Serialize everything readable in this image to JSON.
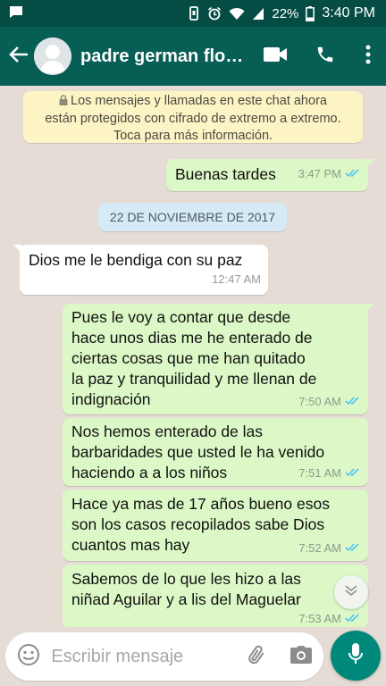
{
  "status_bar": {
    "battery": "22%",
    "time": "3:40 PM",
    "icons": [
      "chat-notification-icon",
      "vibrate-icon",
      "alarm-icon",
      "wifi-icon",
      "signal-icon",
      "battery-icon"
    ]
  },
  "header": {
    "contact_name": "padre german flo…",
    "icons": [
      "back-arrow-icon",
      "avatar-placeholder-icon",
      "video-call-icon",
      "phone-icon",
      "more-vert-icon"
    ]
  },
  "encryption_notice": {
    "line1": "Los mensajes y llamadas en este chat ahora",
    "line2": "están protegidos con cifrado de extremo a extremo.",
    "line3": "Toca para más información."
  },
  "messages": [
    {
      "direction": "out",
      "text": "Buenas tardes",
      "time": "3:47 PM",
      "status": "read"
    },
    {
      "direction": "in",
      "text": "Dios me le bendiga con su paz",
      "time": "12:47 AM"
    },
    {
      "direction": "out",
      "text": "Pues le voy a contar que desde\nhace unos dias me he enterado de\nciertas cosas que me han quitado\nla paz y tranquilidad y me llenan de\nindignación",
      "time": "7:50 AM",
      "status": "read"
    },
    {
      "direction": "out",
      "text": "Nos hemos enterado de las\nbarbaridades que usted le ha venido\nhaciendo a  a los niños",
      "time": "7:51 AM",
      "status": "read"
    },
    {
      "direction": "out",
      "text": "Hace ya mas de 17 años bueno esos\nson los casos recopilados sabe Dios\ncuantos mas hay",
      "time": "7:52 AM",
      "status": "read"
    },
    {
      "direction": "out",
      "text": "Sabemos de lo que les hizo a las\nniñad Aguilar y a lis del Maguelar",
      "time": "7:53 AM",
      "status": "read"
    }
  ],
  "date_divider": "22 DE NOVIEMBRE DE 2017",
  "composer": {
    "placeholder": "Escribir mensaje",
    "icons": [
      "emoji-icon",
      "attach-icon",
      "camera-icon",
      "mic-icon",
      "scroll-down-icon"
    ]
  },
  "colors": {
    "status_bar": "#054d44",
    "app_bar": "#075e54",
    "chat_background": "#e5ddd5",
    "outgoing_bubble": "#dcf8c6",
    "incoming_bubble": "#ffffff",
    "read_ticks": "#4fc3f7",
    "mic_button": "#00897b",
    "notice_background": "#fdf4c5",
    "date_chip": "#d5eaf6"
  }
}
